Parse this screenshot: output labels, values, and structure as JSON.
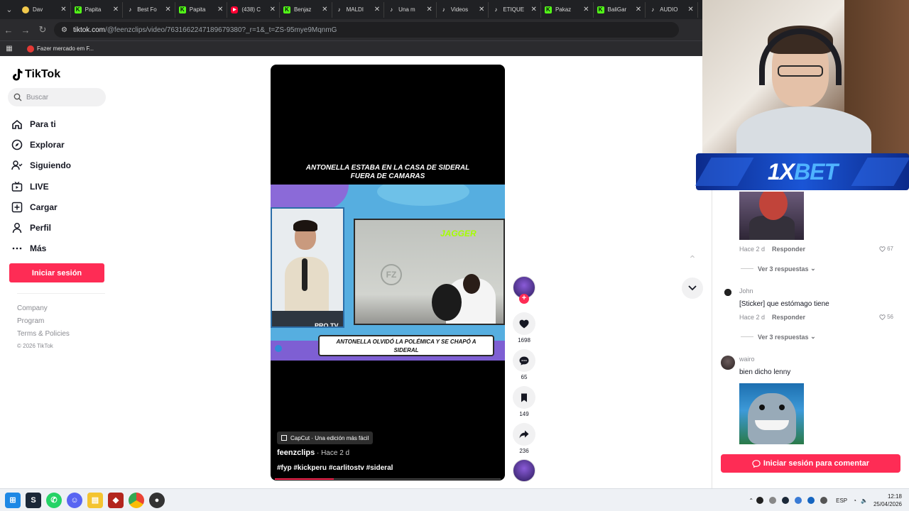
{
  "browser": {
    "tabs": [
      {
        "label": "Dav",
        "icon": "yellow-circle-icon"
      },
      {
        "label": "Papita",
        "icon": "kick-icon"
      },
      {
        "label": "Best Fo",
        "icon": "tiktok-icon"
      },
      {
        "label": "Papita",
        "icon": "kick-icon"
      },
      {
        "label": "(438) C",
        "icon": "youtube-icon"
      },
      {
        "label": "Benjaz",
        "icon": "kick-icon"
      },
      {
        "label": "MALDI",
        "icon": "tiktok-icon"
      },
      {
        "label": "Una m",
        "icon": "tiktok-icon"
      },
      {
        "label": "Videos",
        "icon": "tiktok-icon"
      },
      {
        "label": "ETIQUE",
        "icon": "tiktok-icon"
      },
      {
        "label": "Pakaz",
        "icon": "kick-icon"
      },
      {
        "label": "BaliGar",
        "icon": "kick-icon"
      },
      {
        "label": "AUDIO",
        "icon": "tiktok-icon"
      }
    ],
    "url_host": "tiktok.com",
    "url_path": "/@feenzclips/video/7631662247189679380?_r=1&_t=ZS-95mye9MqnmG",
    "bookmark": "Fazer mercado em F..."
  },
  "sidebar": {
    "brand": "TikTok",
    "search_placeholder": "Buscar",
    "menu": [
      {
        "label": "Para ti",
        "icon": "home-icon"
      },
      {
        "label": "Explorar",
        "icon": "compass-icon"
      },
      {
        "label": "Siguiendo",
        "icon": "following-icon"
      },
      {
        "label": "LIVE",
        "icon": "live-icon"
      },
      {
        "label": "Cargar",
        "icon": "upload-icon"
      },
      {
        "label": "Perfil",
        "icon": "profile-icon"
      },
      {
        "label": "Más",
        "icon": "more-icon"
      }
    ],
    "login": "Iniciar sesión",
    "footer": [
      "Company",
      "Program",
      "Terms & Policies"
    ],
    "copyright": "© 2026 TikTok"
  },
  "video": {
    "top_caption_1": "ANTONELLA ESTABA EN LA CASA DE SIDERAL",
    "top_caption_2": "FUERA DE CAMARAS",
    "bottom_caption_1": "ANTONELLA OLVIDÓ LA POLÉMICA Y SE CHAPÓ A",
    "bottom_caption_2": "SIDERAL",
    "stream_tag": "PRO TV",
    "room_sign": "JAGGER",
    "watermark": "FZ",
    "capcut": "CapCut · Una edición más fácil",
    "author": "feenzclips",
    "time": " · Hace 2 d",
    "tags": "#fyp #kickperu #carlitostv #sideral",
    "progress": 0.26
  },
  "actions": {
    "likes": "1698",
    "comments": "65",
    "saves": "149",
    "shares": "236"
  },
  "comments": {
    "c1": {
      "time": "Hace 2 d",
      "reply": "Responder",
      "likes": "67",
      "view_replies": "Ver 3 respuestas"
    },
    "c2": {
      "user": "John",
      "text": "[Sticker] que estómago tiene",
      "time": "Hace 2 d",
      "reply": "Responder",
      "likes": "56",
      "view_replies": "Ver 3 respuestas"
    },
    "c3": {
      "user": "wairo",
      "text": "bien dicho lenny"
    },
    "cta": "Iniciar sesión para comentar"
  },
  "overlay": {
    "sponsor_a": "1X",
    "sponsor_b": "BET"
  },
  "taskbar": {
    "lang": "ESP",
    "time": "12:18",
    "date": "25/04/2026"
  }
}
